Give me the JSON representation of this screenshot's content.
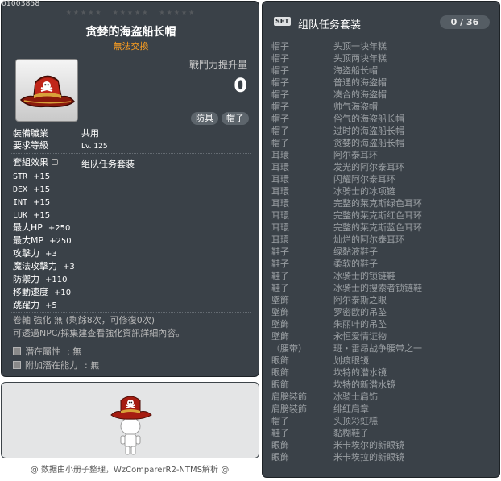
{
  "item_code": "01003858",
  "item": {
    "name": "贪婪的海盗船长帽",
    "trade": "無法交換",
    "power_label": "戰鬥力提升量",
    "power_value": "0",
    "tags": [
      "防具",
      "帽子"
    ]
  },
  "req": {
    "job_label": "裝備職業",
    "job_value": "共用",
    "level_label": "要求等級",
    "level_value": "Lv. 125"
  },
  "set_effect": {
    "label": "套組效果",
    "name": "组队任务套装"
  },
  "stats": [
    {
      "key": "STR",
      "value": "+15"
    },
    {
      "key": "DEX",
      "value": "+15"
    },
    {
      "key": "INT",
      "value": "+15"
    },
    {
      "key": "LUK",
      "value": "+15"
    },
    {
      "key": "最大HP",
      "value": "+250"
    },
    {
      "key": "最大MP",
      "value": "+250"
    },
    {
      "key": "攻擊力",
      "value": "+3"
    },
    {
      "key": "魔法攻擊力",
      "value": "+3"
    },
    {
      "key": "防禦力",
      "value": "+110"
    },
    {
      "key": "移動速度",
      "value": "+10"
    },
    {
      "key": "跳躍力",
      "value": "+5"
    }
  ],
  "enhance": {
    "line1": "卷軸 強化 無 (剩餘8次，可修復0次)",
    "line2": "可透過NPC/採集建查看強化資訊詳細內容。"
  },
  "potential": {
    "label": "潛在屬性",
    "value": "無",
    "bonus_label": "附加潛在能力",
    "bonus_value": "無"
  },
  "footer": "@ 数据由小册子整理，WzComparerR2-NTMS解析 @",
  "set_panel": {
    "badge": "SET",
    "title": "组队任务套装",
    "count": "0 / 36",
    "items": [
      {
        "cat": "帽子",
        "name": "头顶一块年糕"
      },
      {
        "cat": "帽子",
        "name": "头顶两块年糕"
      },
      {
        "cat": "帽子",
        "name": "海盗船长帽"
      },
      {
        "cat": "帽子",
        "name": "普通的海盗帽"
      },
      {
        "cat": "帽子",
        "name": "凑合的海盗帽"
      },
      {
        "cat": "帽子",
        "name": "帅气海盗帽"
      },
      {
        "cat": "帽子",
        "name": "俗气的海盗船长帽"
      },
      {
        "cat": "帽子",
        "name": "过时的海盗船长帽"
      },
      {
        "cat": "帽子",
        "name": "贪婪的海盗船长帽"
      },
      {
        "cat": "耳環",
        "name": "阿尔泰耳环"
      },
      {
        "cat": "耳環",
        "name": "发光的阿尔泰耳环"
      },
      {
        "cat": "耳環",
        "name": "闪耀阿尔泰耳环"
      },
      {
        "cat": "耳環",
        "name": "冰骑士的冰项链"
      },
      {
        "cat": "耳環",
        "name": "完整的莱克斯绿色耳环"
      },
      {
        "cat": "耳環",
        "name": "完整的莱克斯红色耳环"
      },
      {
        "cat": "耳環",
        "name": "完整的莱克斯蓝色耳环"
      },
      {
        "cat": "耳環",
        "name": "灿烂的阿尔泰耳环"
      },
      {
        "cat": "鞋子",
        "name": "绿黏液鞋子"
      },
      {
        "cat": "鞋子",
        "name": "柔软的鞋子"
      },
      {
        "cat": "鞋子",
        "name": "冰骑士的锁链鞋"
      },
      {
        "cat": "鞋子",
        "name": "冰骑士的搜索者锁链鞋"
      },
      {
        "cat": "墜飾",
        "name": "阿尔泰斯之眼"
      },
      {
        "cat": "墜飾",
        "name": "罗密欧的吊坠"
      },
      {
        "cat": "墜飾",
        "name": "朱丽叶的吊坠"
      },
      {
        "cat": "墜飾",
        "name": "永恒爱情证物"
      },
      {
        "cat": "（腰带）",
        "name": "班・雷昂战争腰带之一"
      },
      {
        "cat": "眼飾",
        "name": "划痕眼镜"
      },
      {
        "cat": "眼飾",
        "name": "坎特的潜水镜"
      },
      {
        "cat": "眼飾",
        "name": "坎特的新潜水镜"
      },
      {
        "cat": "肩膀裝飾",
        "name": "冰骑士肩饰"
      },
      {
        "cat": "肩膀裝飾",
        "name": "绯红肩章"
      },
      {
        "cat": "帽子",
        "name": "头顶彩虹糕"
      },
      {
        "cat": "鞋子",
        "name": "黏糊鞋子"
      },
      {
        "cat": "眼飾",
        "name": "米卡埃尔的新眼镜"
      },
      {
        "cat": "眼飾",
        "name": "米卡埃拉的新眼镜"
      }
    ]
  }
}
